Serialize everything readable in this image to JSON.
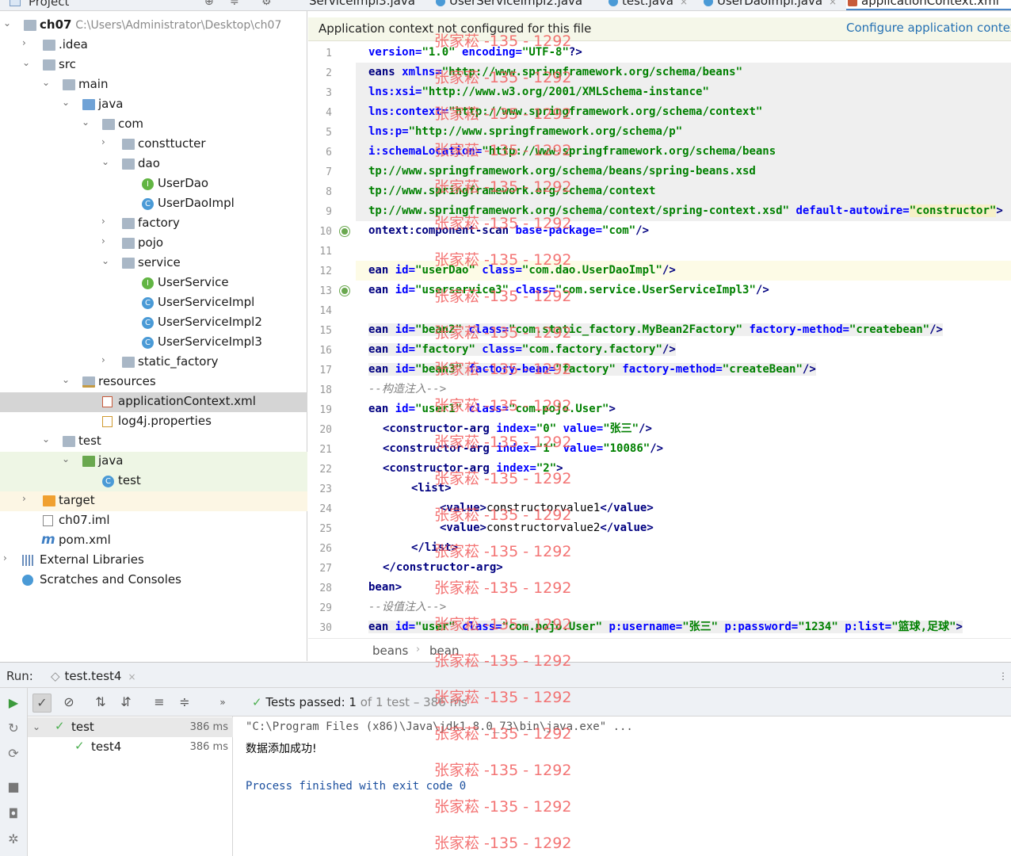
{
  "project_bar": {
    "label": "Project",
    "tools": [
      "⊕",
      "≑",
      "⚙"
    ]
  },
  "tabs": [
    {
      "label": "ServiceImpl3.java",
      "close": ""
    },
    {
      "label": "UserServiceImpl2.java",
      "close": ""
    },
    {
      "label": "test.java",
      "close": "×"
    },
    {
      "label": "UserDaoImpl.java",
      "close": "×"
    },
    {
      "label": "applicationContext.xml",
      "close": "×"
    }
  ],
  "tree": [
    {
      "label": "ch07",
      "path": "C:\\Users\\Administrator\\Desktop\\ch07"
    },
    {
      "label": ".idea"
    },
    {
      "label": "src"
    },
    {
      "label": "main"
    },
    {
      "label": "java"
    },
    {
      "label": "com"
    },
    {
      "label": "consttucter"
    },
    {
      "label": "dao"
    },
    {
      "label": "UserDao",
      "kind": "I"
    },
    {
      "label": "UserDaoImpl",
      "kind": "C"
    },
    {
      "label": "factory"
    },
    {
      "label": "pojo"
    },
    {
      "label": "service"
    },
    {
      "label": "UserService",
      "kind": "I"
    },
    {
      "label": "UserServiceImpl",
      "kind": "C"
    },
    {
      "label": "UserServiceImpl2",
      "kind": "C"
    },
    {
      "label": "UserServiceImpl3",
      "kind": "C"
    },
    {
      "label": "static_factory"
    },
    {
      "label": "resources"
    },
    {
      "label": "applicationContext.xml"
    },
    {
      "label": "log4j.properties"
    },
    {
      "label": "test"
    },
    {
      "label": "java"
    },
    {
      "label": "test",
      "kind": "C"
    },
    {
      "label": "target"
    },
    {
      "label": "ch07.iml"
    },
    {
      "label": "pom.xml"
    },
    {
      "label": "External Libraries"
    },
    {
      "label": "Scratches and Consoles"
    }
  ],
  "notice": {
    "text": "Application context not configured for this file",
    "action": "Configure application context"
  },
  "line_numbers": [
    "1",
    "2",
    "3",
    "4",
    "5",
    "6",
    "7",
    "8",
    "9",
    "10",
    "11",
    "12",
    "13",
    "14",
    "15",
    "16",
    "17",
    "18",
    "19",
    "20",
    "21",
    "22",
    "23",
    "24",
    "25",
    "26",
    "27",
    "28",
    "29",
    "30"
  ],
  "code": {
    "l1": {
      "a": "version=",
      "b": "\"1.0\"",
      "c": " encoding=",
      "d": "\"UTF-8\"",
      "e": "?>"
    },
    "l2": {
      "a": "eans ",
      "b": "xmlns=",
      "c": "\"http://www.springframework.org/schema/beans\""
    },
    "l3": {
      "a": "lns:xsi=",
      "b": "\"http://www.w3.org/2001/XMLSchema-instance\""
    },
    "l4": {
      "a": "lns:context=",
      "b": "\"http://www.springframework.org/schema/context\""
    },
    "l5": {
      "a": "lns:p=",
      "b": "\"http://www.springframework.org/schema/p\""
    },
    "l6": {
      "a": "i:schemaLocation=",
      "b": "\"http://www.springframework.org/schema/beans"
    },
    "l7": {
      "a": "tp://www.springframework.org/schema/beans/spring-beans.xsd"
    },
    "l8": {
      "a": "tp://www.springframework.org/schema/context"
    },
    "l9": {
      "a": "tp://www.springframework.org/schema/context/spring-context.xsd\"",
      "b": " default-autowire=",
      "c": "\"constructor\"",
      "d": ">"
    },
    "l10": {
      "a": "ontext:component-scan ",
      "b": "base-package=",
      "c": "\"com\"",
      "d": "/>"
    },
    "l12": {
      "a": "ean ",
      "b": "id=",
      "c": "\"userDao\"",
      "d": " class=",
      "e": "\"com.dao.UserDaoImpl\"",
      "f": "/>"
    },
    "l13": {
      "a": "ean ",
      "b": "id=",
      "c": "\"userservice3\"",
      "d": " class=",
      "e": "\"com.service.UserServiceImpl3\"",
      "f": "/>"
    },
    "l15": {
      "a": "ean ",
      "b": "id=",
      "c": "\"bean2\"",
      "d": " class=",
      "e": "\"com.static_factory.MyBean2Factory\"",
      "f": " factory-method=",
      "g": "\"createbean\"",
      "h": "/>"
    },
    "l16": {
      "a": "ean ",
      "b": "id=",
      "c": "\"factory\"",
      "d": " class=",
      "e": "\"com.factory.factory\"",
      "f": "/>"
    },
    "l17": {
      "a": "ean ",
      "b": "id=",
      "c": "\"bean3\"",
      "d": " factory-bean=",
      "e": "\"factory\"",
      "f": " factory-method=",
      "g": "\"createBean\"",
      "h": "/>"
    },
    "l18": {
      "a": "--构造注入-->"
    },
    "l19": {
      "a": "ean ",
      "b": "id=",
      "c": "\"user1\"",
      "d": " class=",
      "e": "\"com.pojo.User\"",
      "f": ">"
    },
    "l20": {
      "a": "<constructor-arg ",
      "b": "index=",
      "c": "\"0\"",
      "d": " value=",
      "e": "\"张三\"",
      "f": "/>"
    },
    "l21": {
      "a": "<constructor-arg ",
      "b": "index=",
      "c": "\"1\"",
      "d": " value=",
      "e": "\"10086\"",
      "f": "/>"
    },
    "l22": {
      "a": "<constructor-arg ",
      "b": "index=",
      "c": "\"2\"",
      "d": ">"
    },
    "l23": {
      "a": "<list>"
    },
    "l24": {
      "a": "<value>",
      "b": "constructorvalue1",
      "c": "</value>"
    },
    "l25": {
      "a": "<value>",
      "b": "constructorvalue2",
      "c": "</value>"
    },
    "l26": {
      "a": "</list>"
    },
    "l27": {
      "a": "</constructor-arg>"
    },
    "l28": {
      "a": "bean>"
    },
    "l29": {
      "a": "--设值注入-->"
    },
    "l30": {
      "a": "ean ",
      "b": "id=",
      "c": "\"user\"",
      "d": " class=",
      "e": "\"com.pojo.User\"",
      "f": " p:username=",
      "g": "\"张三\"",
      "h": " p:password=",
      "i": "\"1234\"",
      "j": " p:list=",
      "k": "\"篮球,足球\"",
      "l": ">"
    }
  },
  "breadcrumb": [
    "beans",
    "bean"
  ],
  "run": {
    "label": "Run:",
    "config": "test.test4",
    "close": "×",
    "passed_prefix": "Tests passed: ",
    "passed_count": "1",
    "passed_suffix": " of 1 test – 386 ms"
  },
  "test_tree": [
    {
      "label": "test",
      "time": "386 ms"
    },
    {
      "label": "test4",
      "time": "386 ms"
    }
  ],
  "console": {
    "cmd": "\"C:\\Program Files (x86)\\Java\\jdk1.8.0_73\\bin\\java.exe\" ...",
    "out": "数据添加成功!",
    "finish": "Process finished with exit code 0"
  },
  "watermark": "张家菘 -135 - 1292",
  "colors": {
    "tag": "#000080",
    "attr": "#0000ff",
    "value": "#008000",
    "comment": "#808080",
    "accent": "#4a86c7"
  }
}
